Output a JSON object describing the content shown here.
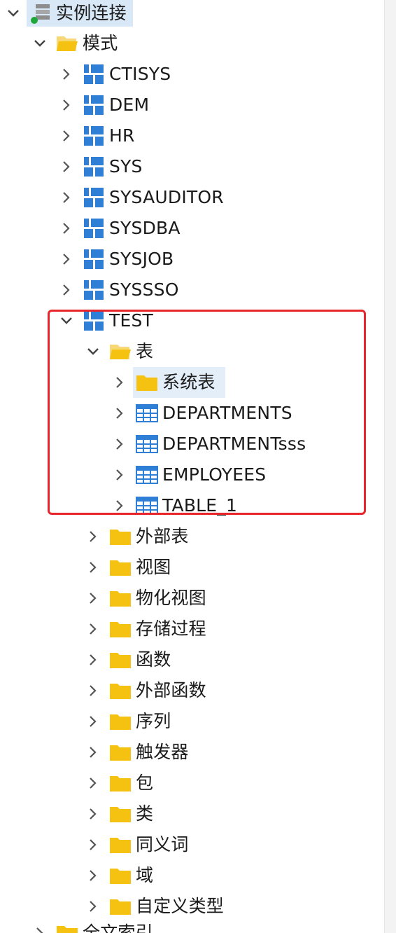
{
  "tree": {
    "root": {
      "label": "实例连接",
      "icon": "database-connection-icon"
    },
    "schemas_folder": {
      "label": "模式",
      "icon": "folder-open-icon"
    },
    "schemas": [
      {
        "label": "CTISYS",
        "icon": "schema-icon"
      },
      {
        "label": "DEM",
        "icon": "schema-icon"
      },
      {
        "label": "HR",
        "icon": "schema-icon"
      },
      {
        "label": "SYS",
        "icon": "schema-icon"
      },
      {
        "label": "SYSAUDITOR",
        "icon": "schema-icon"
      },
      {
        "label": "SYSDBA",
        "icon": "schema-icon"
      },
      {
        "label": "SYSJOB",
        "icon": "schema-icon"
      },
      {
        "label": "SYSSSO",
        "icon": "schema-icon"
      },
      {
        "label": "TEST",
        "icon": "schema-icon"
      }
    ],
    "tables_folder": {
      "label": "表",
      "icon": "folder-open-icon"
    },
    "tables": [
      {
        "label": "系统表",
        "icon": "folder-icon"
      },
      {
        "label": "DEPARTMENTS",
        "icon": "table-icon"
      },
      {
        "label": "DEPARTMENTsss",
        "icon": "table-icon"
      },
      {
        "label": "EMPLOYEES",
        "icon": "table-icon"
      },
      {
        "label": "TABLE_1",
        "icon": "table-icon"
      }
    ],
    "object_folders": [
      {
        "label": "外部表",
        "icon": "folder-icon"
      },
      {
        "label": "视图",
        "icon": "folder-icon"
      },
      {
        "label": "物化视图",
        "icon": "folder-icon"
      },
      {
        "label": "存储过程",
        "icon": "folder-icon"
      },
      {
        "label": "函数",
        "icon": "folder-icon"
      },
      {
        "label": "外部函数",
        "icon": "folder-icon"
      },
      {
        "label": "序列",
        "icon": "folder-icon"
      },
      {
        "label": "触发器",
        "icon": "folder-icon"
      },
      {
        "label": "包",
        "icon": "folder-icon"
      },
      {
        "label": "类",
        "icon": "folder-icon"
      },
      {
        "label": "同义词",
        "icon": "folder-icon"
      },
      {
        "label": "域",
        "icon": "folder-icon"
      },
      {
        "label": "自定义类型",
        "icon": "folder-icon"
      }
    ],
    "global_index": {
      "label": "全文索引",
      "icon": "folder-icon"
    }
  },
  "colors": {
    "folder": "#f5c211",
    "schema": "#2f7fd6",
    "table_header": "#2f7fd6",
    "highlight_box": "#e8252a",
    "status_dot": "#1fa83a",
    "chevron": "#555555"
  }
}
